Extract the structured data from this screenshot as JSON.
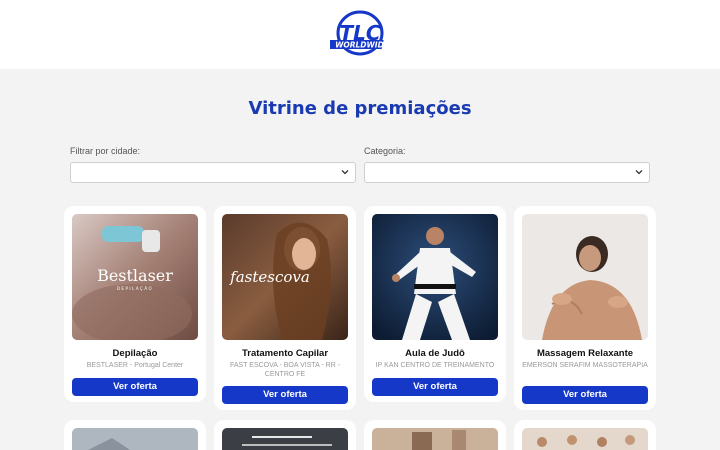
{
  "header": {
    "logo_text": "TLC",
    "logo_subtext": "WORLDWIDE"
  },
  "page": {
    "title": "Vitrine de premiações"
  },
  "filters": {
    "city_label": "Filtrar por cidade:",
    "category_label": "Categoria:",
    "city_value": "",
    "category_value": ""
  },
  "colors": {
    "brand_blue": "#1638c8",
    "title_blue": "#1a3ab2",
    "background": "#f3f3f3"
  },
  "offers": [
    {
      "name": "Depilação",
      "partner": "BESTLASER - Portugal Center",
      "image_text": "Bestlaser",
      "image_subtext": "DEPILAÇÃO",
      "button": "Ver oferta"
    },
    {
      "name": "Tratamento Capilar",
      "partner": "FAST ESCOVA - BOA VISTA - RR - CENTRO FE",
      "image_text": "fastescova",
      "button": "Ver oferta"
    },
    {
      "name": "Aula de Judô",
      "partner": "IP KAN CENTRO DE TREINAMENTO",
      "button": "Ver oferta"
    },
    {
      "name": "Massagem Relaxante",
      "partner": "EMERSON SERAFIM MASSOTERAPIA",
      "button": "Ver oferta"
    }
  ]
}
